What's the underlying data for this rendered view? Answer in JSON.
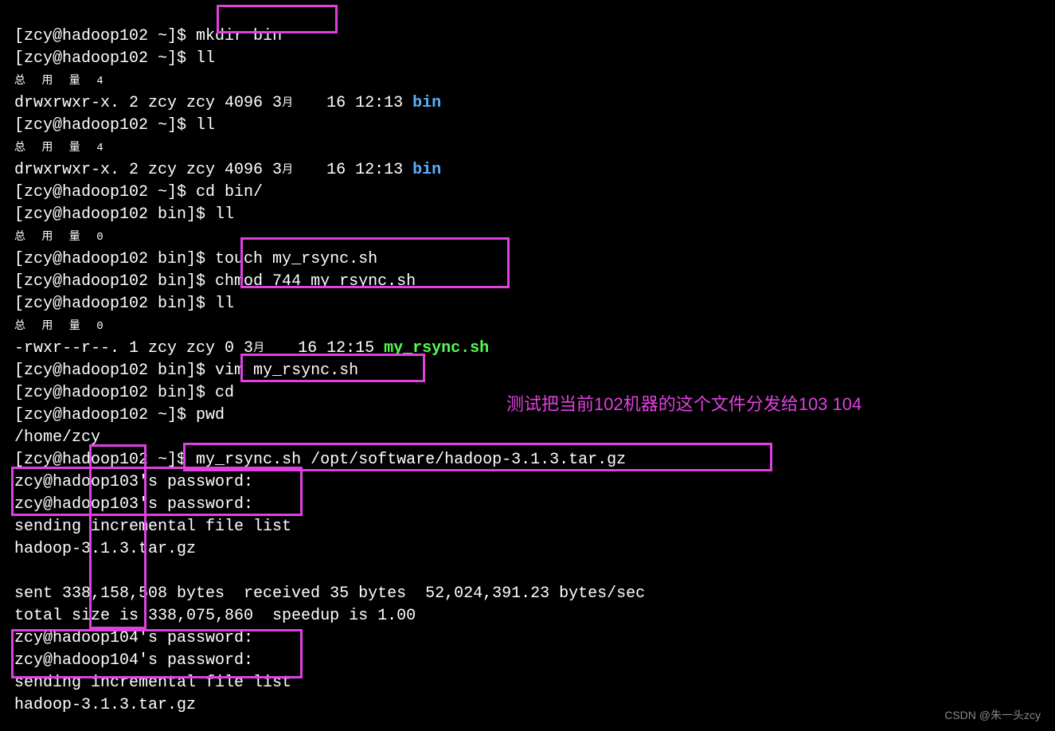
{
  "prompt_home": "[zcy@hadoop102 ~]$ ",
  "prompt_bin": "[zcy@hadoop102 bin]$ ",
  "cmd_mkdir": "mkdir bin",
  "cmd_ll": "ll",
  "total4": "总 用 量 4",
  "total0": "总 用 量 0",
  "ls_bin_prefix": "drwxrwxr-x. 2 zcy zcy 4096 3",
  "month_char": "月",
  "ls_bin_suffix": "   16 12:13 ",
  "bin_name": "bin",
  "cmd_cdbin": "cd bin/",
  "cmd_touch": "touch my_rsync.sh",
  "cmd_chmod": "chmod 744 my_rsync.sh",
  "ls_rsync_prefix": "-rwxr--r--. 1 zcy zcy 0 3",
  "ls_rsync_suffix": "   16 12:15 ",
  "rsync_name": "my_rsync.sh",
  "cmd_vim": "vim my_rsync.sh",
  "cmd_cd": "cd",
  "cmd_pwd": "pwd",
  "pwd_out": "/home/zcy",
  "cmd_rsync": "my_rsync.sh /opt/software/hadoop-3.1.3.tar.gz",
  "pw103": "zcy@hadoop103's password: ",
  "send_list": "sending incremental file list",
  "tarfile": "hadoop-3.1.3.tar.gz",
  "sent_line": "sent 338,158,508 bytes  received 35 bytes  52,024,391.23 bytes/sec",
  "total_line": "total size is 338,075,860  speedup is 1.00",
  "pw104": "zcy@hadoop104's password: ",
  "annotation": "测试把当前102机器的这个文件分发给103 104",
  "watermark": "CSDN @朱一头zcy"
}
